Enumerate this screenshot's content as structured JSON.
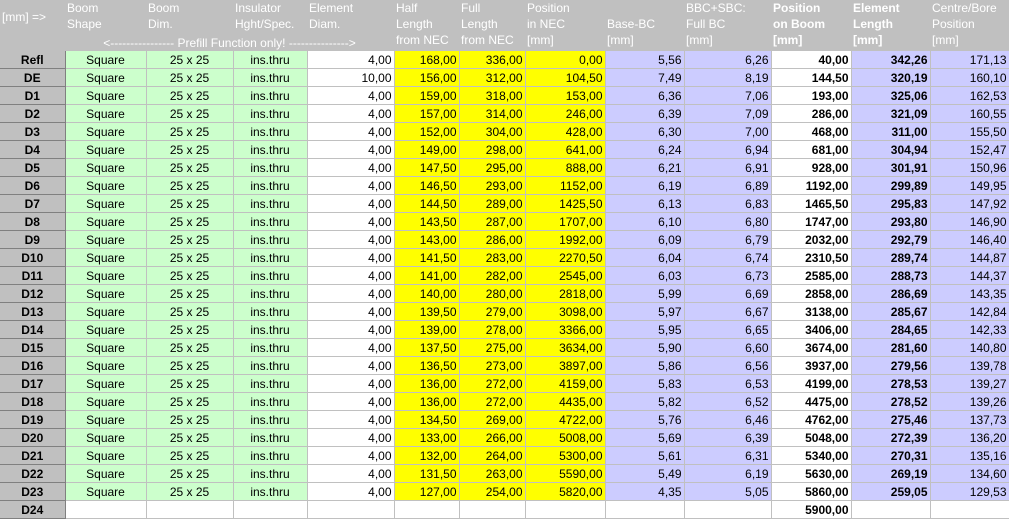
{
  "header": {
    "units": "[mm] =>",
    "columns": [
      [
        "Boom",
        "Shape"
      ],
      [
        "Boom",
        "Dim."
      ],
      [
        "Insulator",
        "Hght/Spec."
      ],
      [
        "Element",
        "Diam."
      ],
      [
        "Half",
        "Length",
        "from NEC"
      ],
      [
        "Full",
        "Length",
        "from NEC"
      ],
      [
        "Position",
        "in NEC",
        "[mm]"
      ],
      [
        "",
        "Base-BC",
        "[mm]"
      ],
      [
        "BBC+SBC:",
        "Full BC",
        "[mm]"
      ],
      [
        "Position",
        "on Boom",
        "[mm]"
      ],
      [
        "Element",
        "Length",
        "[mm]"
      ],
      [
        "Centre/Bore",
        "Position",
        "[mm]"
      ]
    ],
    "prefill_note": "<---------------- Prefill Function only! --------------->"
  },
  "rows": [
    [
      "Refl",
      "Square",
      "25 x 25",
      "ins.thru",
      "4,00",
      "168,00",
      "336,00",
      "0,00",
      "5,56",
      "6,26",
      "40,00",
      "342,26",
      "171,13"
    ],
    [
      "DE",
      "Square",
      "25 x 25",
      "ins.thru",
      "10,00",
      "156,00",
      "312,00",
      "104,50",
      "7,49",
      "8,19",
      "144,50",
      "320,19",
      "160,10"
    ],
    [
      "D1",
      "Square",
      "25 x 25",
      "ins.thru",
      "4,00",
      "159,00",
      "318,00",
      "153,00",
      "6,36",
      "7,06",
      "193,00",
      "325,06",
      "162,53"
    ],
    [
      "D2",
      "Square",
      "25 x 25",
      "ins.thru",
      "4,00",
      "157,00",
      "314,00",
      "246,00",
      "6,39",
      "7,09",
      "286,00",
      "321,09",
      "160,55"
    ],
    [
      "D3",
      "Square",
      "25 x 25",
      "ins.thru",
      "4,00",
      "152,00",
      "304,00",
      "428,00",
      "6,30",
      "7,00",
      "468,00",
      "311,00",
      "155,50"
    ],
    [
      "D4",
      "Square",
      "25 x 25",
      "ins.thru",
      "4,00",
      "149,00",
      "298,00",
      "641,00",
      "6,24",
      "6,94",
      "681,00",
      "304,94",
      "152,47"
    ],
    [
      "D5",
      "Square",
      "25 x 25",
      "ins.thru",
      "4,00",
      "147,50",
      "295,00",
      "888,00",
      "6,21",
      "6,91",
      "928,00",
      "301,91",
      "150,96"
    ],
    [
      "D6",
      "Square",
      "25 x 25",
      "ins.thru",
      "4,00",
      "146,50",
      "293,00",
      "1152,00",
      "6,19",
      "6,89",
      "1192,00",
      "299,89",
      "149,95"
    ],
    [
      "D7",
      "Square",
      "25 x 25",
      "ins.thru",
      "4,00",
      "144,50",
      "289,00",
      "1425,50",
      "6,13",
      "6,83",
      "1465,50",
      "295,83",
      "147,92"
    ],
    [
      "D8",
      "Square",
      "25 x 25",
      "ins.thru",
      "4,00",
      "143,50",
      "287,00",
      "1707,00",
      "6,10",
      "6,80",
      "1747,00",
      "293,80",
      "146,90"
    ],
    [
      "D9",
      "Square",
      "25 x 25",
      "ins.thru",
      "4,00",
      "143,00",
      "286,00",
      "1992,00",
      "6,09",
      "6,79",
      "2032,00",
      "292,79",
      "146,40"
    ],
    [
      "D10",
      "Square",
      "25 x 25",
      "ins.thru",
      "4,00",
      "141,50",
      "283,00",
      "2270,50",
      "6,04",
      "6,74",
      "2310,50",
      "289,74",
      "144,87"
    ],
    [
      "D11",
      "Square",
      "25 x 25",
      "ins.thru",
      "4,00",
      "141,00",
      "282,00",
      "2545,00",
      "6,03",
      "6,73",
      "2585,00",
      "288,73",
      "144,37"
    ],
    [
      "D12",
      "Square",
      "25 x 25",
      "ins.thru",
      "4,00",
      "140,00",
      "280,00",
      "2818,00",
      "5,99",
      "6,69",
      "2858,00",
      "286,69",
      "143,35"
    ],
    [
      "D13",
      "Square",
      "25 x 25",
      "ins.thru",
      "4,00",
      "139,50",
      "279,00",
      "3098,00",
      "5,97",
      "6,67",
      "3138,00",
      "285,67",
      "142,84"
    ],
    [
      "D14",
      "Square",
      "25 x 25",
      "ins.thru",
      "4,00",
      "139,00",
      "278,00",
      "3366,00",
      "5,95",
      "6,65",
      "3406,00",
      "284,65",
      "142,33"
    ],
    [
      "D15",
      "Square",
      "25 x 25",
      "ins.thru",
      "4,00",
      "137,50",
      "275,00",
      "3634,00",
      "5,90",
      "6,60",
      "3674,00",
      "281,60",
      "140,80"
    ],
    [
      "D16",
      "Square",
      "25 x 25",
      "ins.thru",
      "4,00",
      "136,50",
      "273,00",
      "3897,00",
      "5,86",
      "6,56",
      "3937,00",
      "279,56",
      "139,78"
    ],
    [
      "D17",
      "Square",
      "25 x 25",
      "ins.thru",
      "4,00",
      "136,00",
      "272,00",
      "4159,00",
      "5,83",
      "6,53",
      "4199,00",
      "278,53",
      "139,27"
    ],
    [
      "D18",
      "Square",
      "25 x 25",
      "ins.thru",
      "4,00",
      "136,00",
      "272,00",
      "4435,00",
      "5,82",
      "6,52",
      "4475,00",
      "278,52",
      "139,26"
    ],
    [
      "D19",
      "Square",
      "25 x 25",
      "ins.thru",
      "4,00",
      "134,50",
      "269,00",
      "4722,00",
      "5,76",
      "6,46",
      "4762,00",
      "275,46",
      "137,73"
    ],
    [
      "D20",
      "Square",
      "25 x 25",
      "ins.thru",
      "4,00",
      "133,00",
      "266,00",
      "5008,00",
      "5,69",
      "6,39",
      "5048,00",
      "272,39",
      "136,20"
    ],
    [
      "D21",
      "Square",
      "25 x 25",
      "ins.thru",
      "4,00",
      "132,00",
      "264,00",
      "5300,00",
      "5,61",
      "6,31",
      "5340,00",
      "270,31",
      "135,16"
    ],
    [
      "D22",
      "Square",
      "25 x 25",
      "ins.thru",
      "4,00",
      "131,50",
      "263,00",
      "5590,00",
      "5,49",
      "6,19",
      "5630,00",
      "269,19",
      "134,60"
    ],
    [
      "D23",
      "Square",
      "25 x 25",
      "ins.thru",
      "4,00",
      "127,00",
      "254,00",
      "5820,00",
      "4,35",
      "5,05",
      "5860,00",
      "259,05",
      "129,53"
    ],
    [
      "D24",
      "",
      "",
      "",
      "",
      "",
      "",
      "",
      "",
      "",
      "5900,00",
      "",
      ""
    ]
  ],
  "colors": {
    "green": "#ccffcc",
    "yellow": "#ffff00",
    "lavender": "#ccccff",
    "grey": "#c0c0c0"
  }
}
